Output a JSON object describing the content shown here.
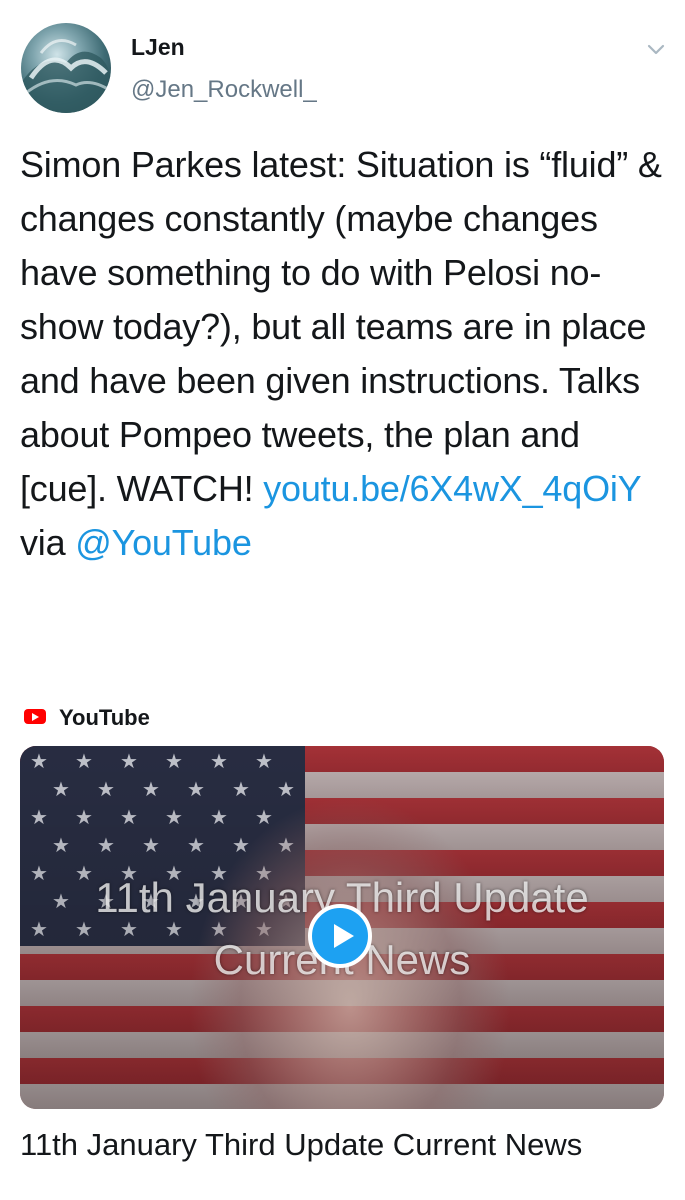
{
  "author": {
    "display_name": "LJen",
    "handle": "@Jen_Rockwell_"
  },
  "icons": {
    "caret": "chevron-down-icon",
    "avatar": "avatar-wave-image",
    "source": "youtube-logo-icon",
    "play": "play-icon"
  },
  "tweet": {
    "text": "Simon Parkes latest: Situation is “fluid” & changes constantly (maybe changes have something to do with Pelosi no-show today?), but all teams are in place and have been given instructions. Talks about Pompeo tweets, the plan and [cue]. WATCH!",
    "link": "youtu.be/6X4wX_4qOiY",
    "via_label": "via",
    "mention": "@YouTube"
  },
  "card": {
    "source_label": "YouTube",
    "thumbnail_title_line1": "11th January Third Update",
    "thumbnail_title_line2": "Current News",
    "title": "11th January Third Update Current News"
  },
  "colors": {
    "link": "#1b95e0",
    "secondary_text": "#657786",
    "play_button": "#1da1f2",
    "youtube_red": "#ff0000"
  }
}
